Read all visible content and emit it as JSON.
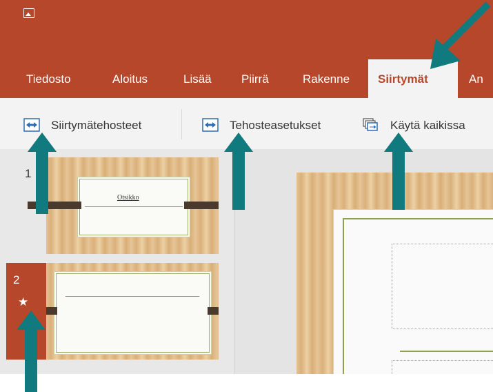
{
  "ribbon": {
    "tabs": [
      {
        "label": "Tiedosto"
      },
      {
        "label": "Aloitus"
      },
      {
        "label": "Lisää"
      },
      {
        "label": "Piirrä"
      },
      {
        "label": "Rakenne"
      },
      {
        "label": "Siirtymät",
        "active": true
      },
      {
        "label": "An"
      }
    ]
  },
  "commands": {
    "transitions": "Siirtymätehosteet",
    "effect_options": "Tehosteasetukset",
    "apply_to_all": "Käytä kaikissa"
  },
  "slides": [
    {
      "number": "1",
      "title": "Otsikko"
    },
    {
      "number": "2",
      "transition_marker": "★"
    }
  ],
  "colors": {
    "accent": "#b7472a",
    "arrow": "#117a7e",
    "theme_green": "#8fa34a"
  }
}
